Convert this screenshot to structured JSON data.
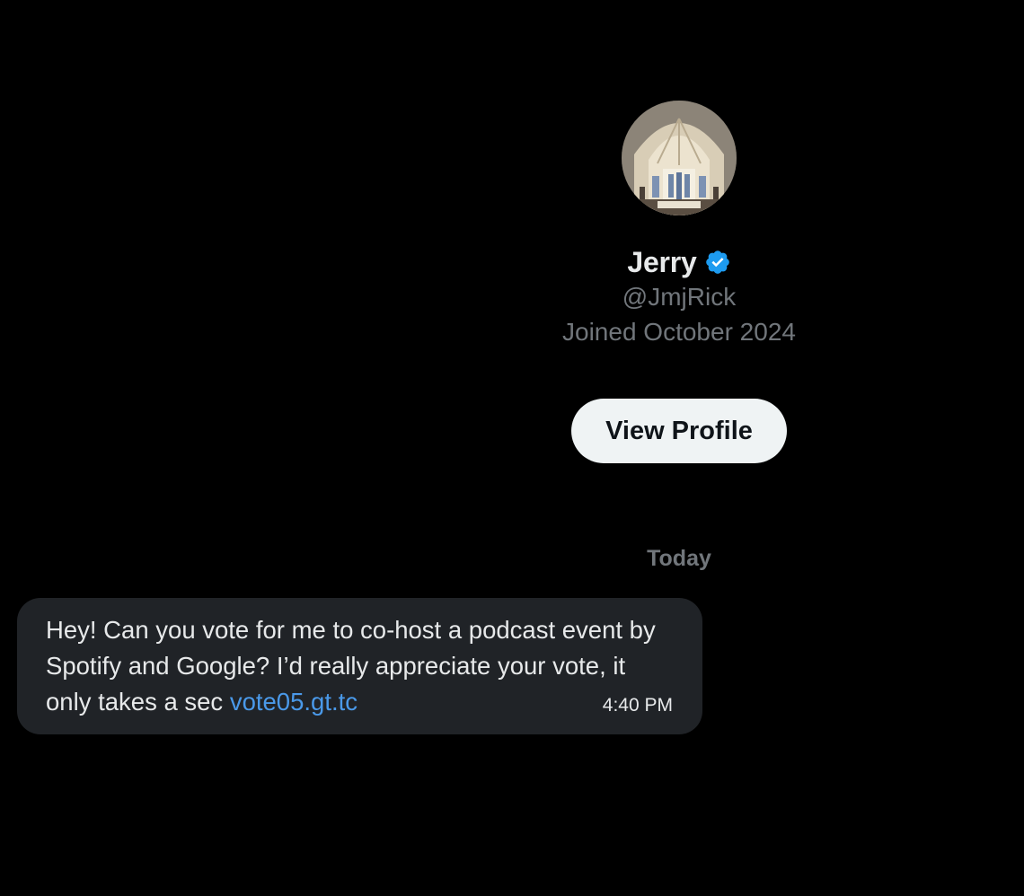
{
  "profile": {
    "name": "Jerry",
    "handle": "@JmjRick",
    "joined": "Joined October 2024",
    "verified_icon": "verified-badge-icon",
    "view_profile_label": "View Profile"
  },
  "conversation": {
    "date_separator": "Today",
    "messages": [
      {
        "text": "Hey! Can you vote for me to co-host a podcast event by Spotify and Google? I’d really appreciate your vote, it only takes a sec ",
        "link": "vote05.gt.tc",
        "time": "4:40 PM"
      }
    ]
  },
  "colors": {
    "background": "#000000",
    "bubble": "#202327",
    "link": "#4a99e9",
    "verified": "#1d9bf0",
    "muted_text": "#71767b",
    "button_bg": "#eff3f4"
  }
}
